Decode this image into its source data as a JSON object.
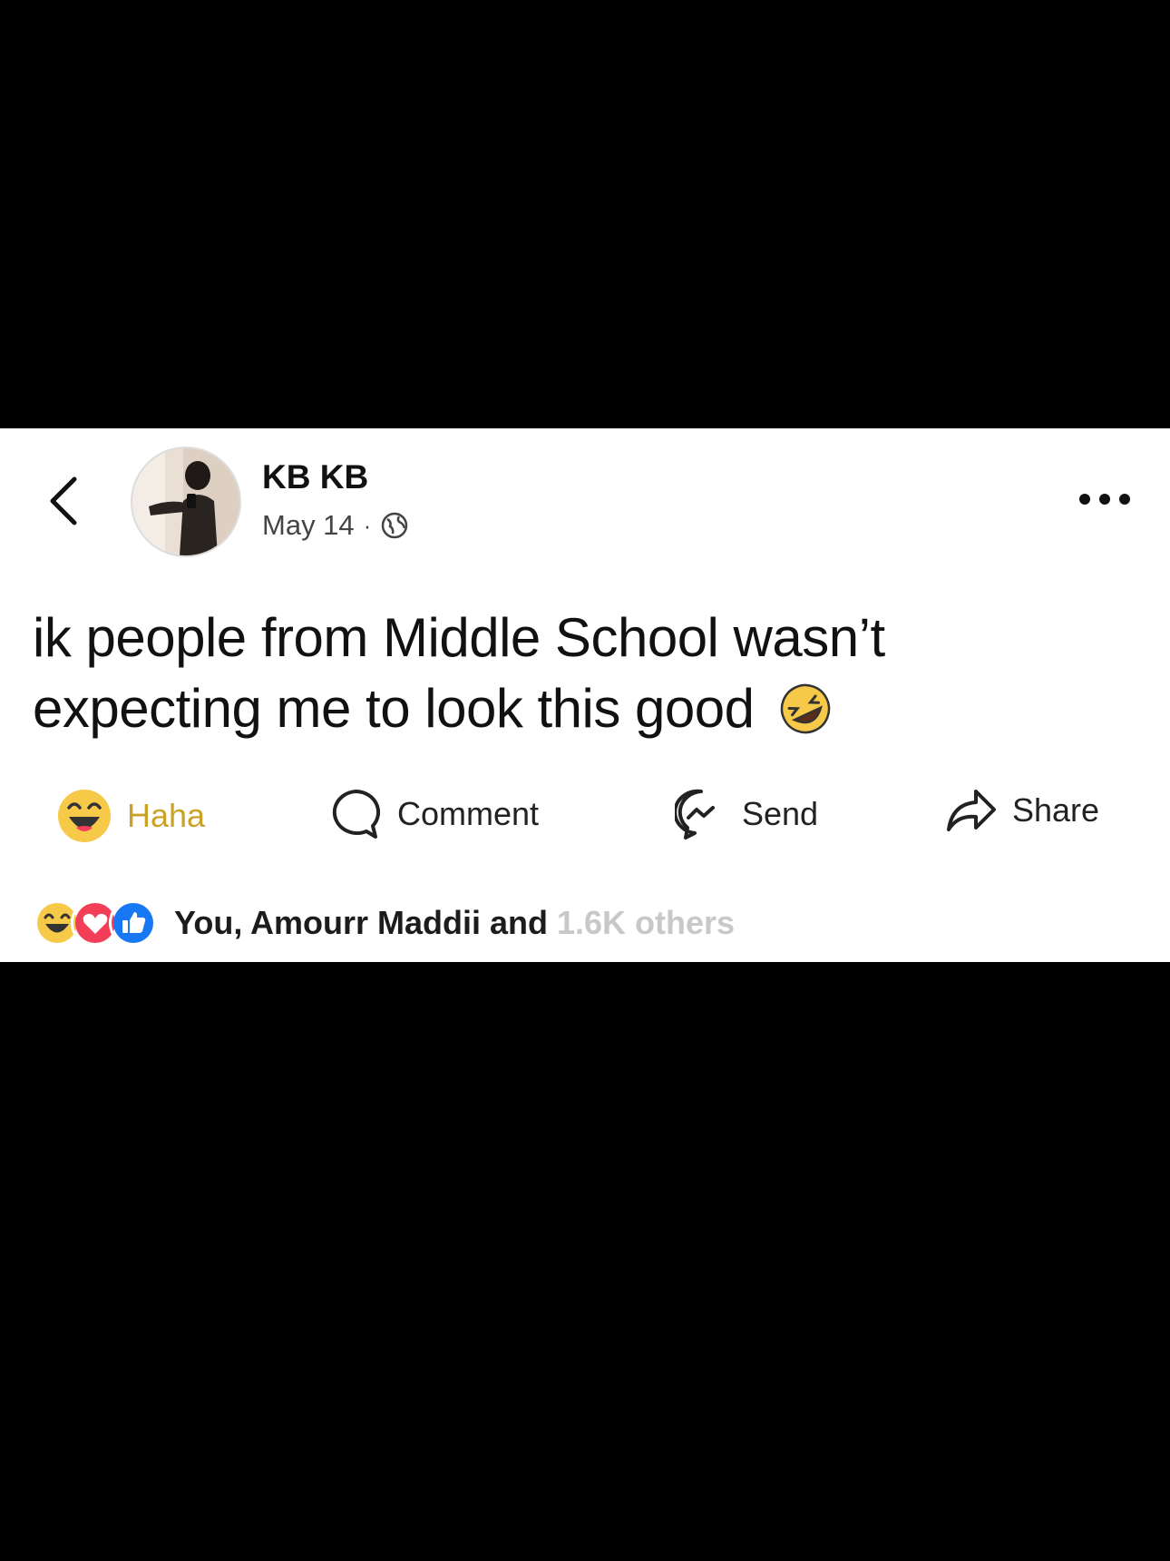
{
  "post": {
    "author": "KB KB",
    "date": "May 14",
    "separator": "·",
    "text_line1": "ik people from Middle School wasn’t",
    "text_line2": "expecting me to look this good",
    "inline_emoji": "rolling-on-floor-laughing-icon"
  },
  "actions": {
    "haha_label": "Haha",
    "comment_label": "Comment",
    "send_label": "Send",
    "share_label": "Share"
  },
  "reactions": {
    "summary": "You, Amourr Maddii and",
    "obscured_tail": "1.6K others",
    "icons": [
      "haha-reaction-icon",
      "love-reaction-icon",
      "like-reaction-icon"
    ]
  },
  "colors": {
    "haha_accent": "#c9a227",
    "like_blue": "#1877f2",
    "love_red": "#f33e58",
    "haha_yellow": "#f7c948"
  }
}
